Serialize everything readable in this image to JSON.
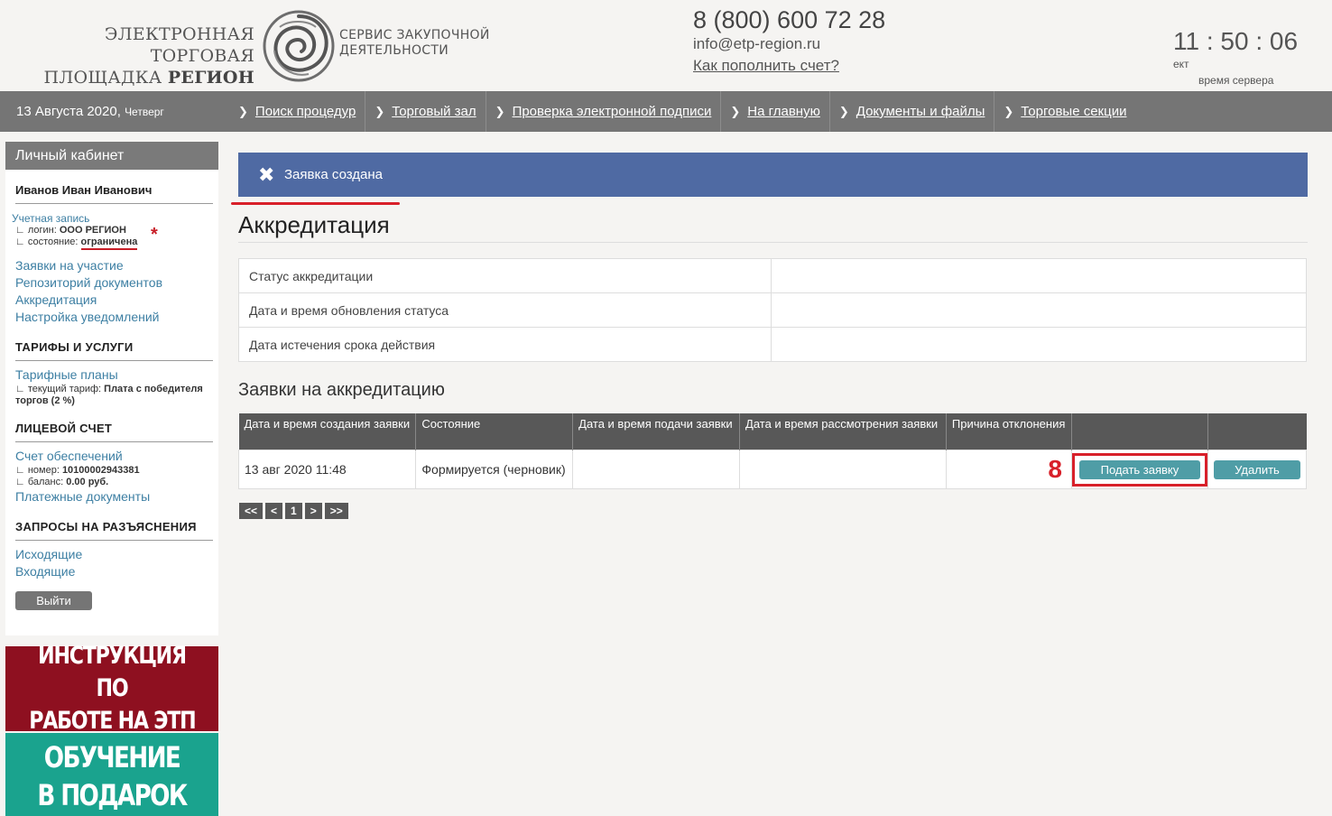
{
  "header": {
    "logo_left_line1": "ЭЛЕКТРОННАЯ ТОРГОВАЯ",
    "logo_left_line2a": "ПЛОЩАДКА ",
    "logo_left_line2b": "РЕГИОН",
    "logo_right_line1": "СЕРВИС ЗАКУПОЧНОЙ",
    "logo_right_line2": "ДЕЯТЕЛЬНОСТИ",
    "phone": "8 (800) 600 72 28",
    "email": "info@etp-region.ru",
    "howto_link": "Как пополнить счет?",
    "clock_time": "11 : 50 : 06",
    "clock_tz": "ект",
    "clock_label": "время сервера"
  },
  "navbar": {
    "date": "13 Августа 2020,",
    "weekday": "Четверг",
    "items": [
      {
        "label": "Поиск процедур"
      },
      {
        "label": "Торговый зал"
      },
      {
        "label": "Проверка электронной подписи"
      },
      {
        "label": "На главную"
      },
      {
        "label": "Документы и файлы"
      },
      {
        "label": "Торговые секции"
      }
    ]
  },
  "sidebar": {
    "title": "Личный кабинет",
    "user_name": "Иванов Иван Иванович",
    "account_link": "Учетная запись",
    "login_label": "∟ логин:",
    "login_value": "ООО РЕГИОН",
    "state_label": "∟ состояние:",
    "state_value": "ограничена",
    "star": "*",
    "links": [
      "Заявки на участие",
      "Репозиторий документов",
      "Аккредитация",
      "Настройка уведомлений"
    ],
    "tariffs_title": "ТАРИФЫ И УСЛУГИ",
    "tariff_link": "Тарифные планы",
    "tariff_label": "∟ текущий тариф:",
    "tariff_value": "Плата с победителя торгов (2 %)",
    "account_title": "ЛИЦЕВОЙ СЧЕТ",
    "deposit_link": "Счет обеспечений",
    "number_label": "∟ номер:",
    "number_value": "10100002943381",
    "balance_label": "∟ баланс:",
    "balance_value": "0.00 руб.",
    "payments_link": "Платежные документы",
    "requests_title": "ЗАПРОСЫ НА РАЗЪЯСНЕНИЯ",
    "outgoing_link": "Исходящие",
    "incoming_link": "Входящие",
    "logout_label": "Выйти"
  },
  "banners": {
    "b1_line1": "ИНСТРУКЦИЯ ПО",
    "b1_line2": "РАБОТЕ НА ЭТП",
    "b2_line1": "ОБУЧЕНИЕ",
    "b2_line2": "В ПОДАРОК"
  },
  "main": {
    "notice": "Заявка создана",
    "title": "Аккредитация",
    "status_rows": [
      {
        "label": "Статус аккредитации",
        "value": ""
      },
      {
        "label": "Дата и время обновления статуса",
        "value": ""
      },
      {
        "label": "Дата истечения срока действия",
        "value": ""
      }
    ],
    "requests_title": "Заявки на аккредитацию",
    "columns": [
      "Дата и время создания заявки",
      "Состояние",
      "Дата и время подачи заявки",
      "Дата и время рассмотрения заявки",
      "Причина отклонения",
      "",
      ""
    ],
    "rows": [
      {
        "created": "13 авг 2020 11:48",
        "state": "Формируется (черновик)",
        "submitted": "",
        "reviewed": "",
        "reason": "",
        "marker": "8",
        "submit_label": "Подать заявку",
        "delete_label": "Удалить"
      }
    ],
    "pager": [
      "<<",
      "<",
      "1",
      ">",
      ">>"
    ]
  },
  "colors": {
    "navbar": "#757575",
    "notice": "#4f6aa3",
    "teal_button": "#4f9da6",
    "highlight_red": "#d8202a",
    "banner1": "#8e1020",
    "banner2": "#1aa38e"
  }
}
